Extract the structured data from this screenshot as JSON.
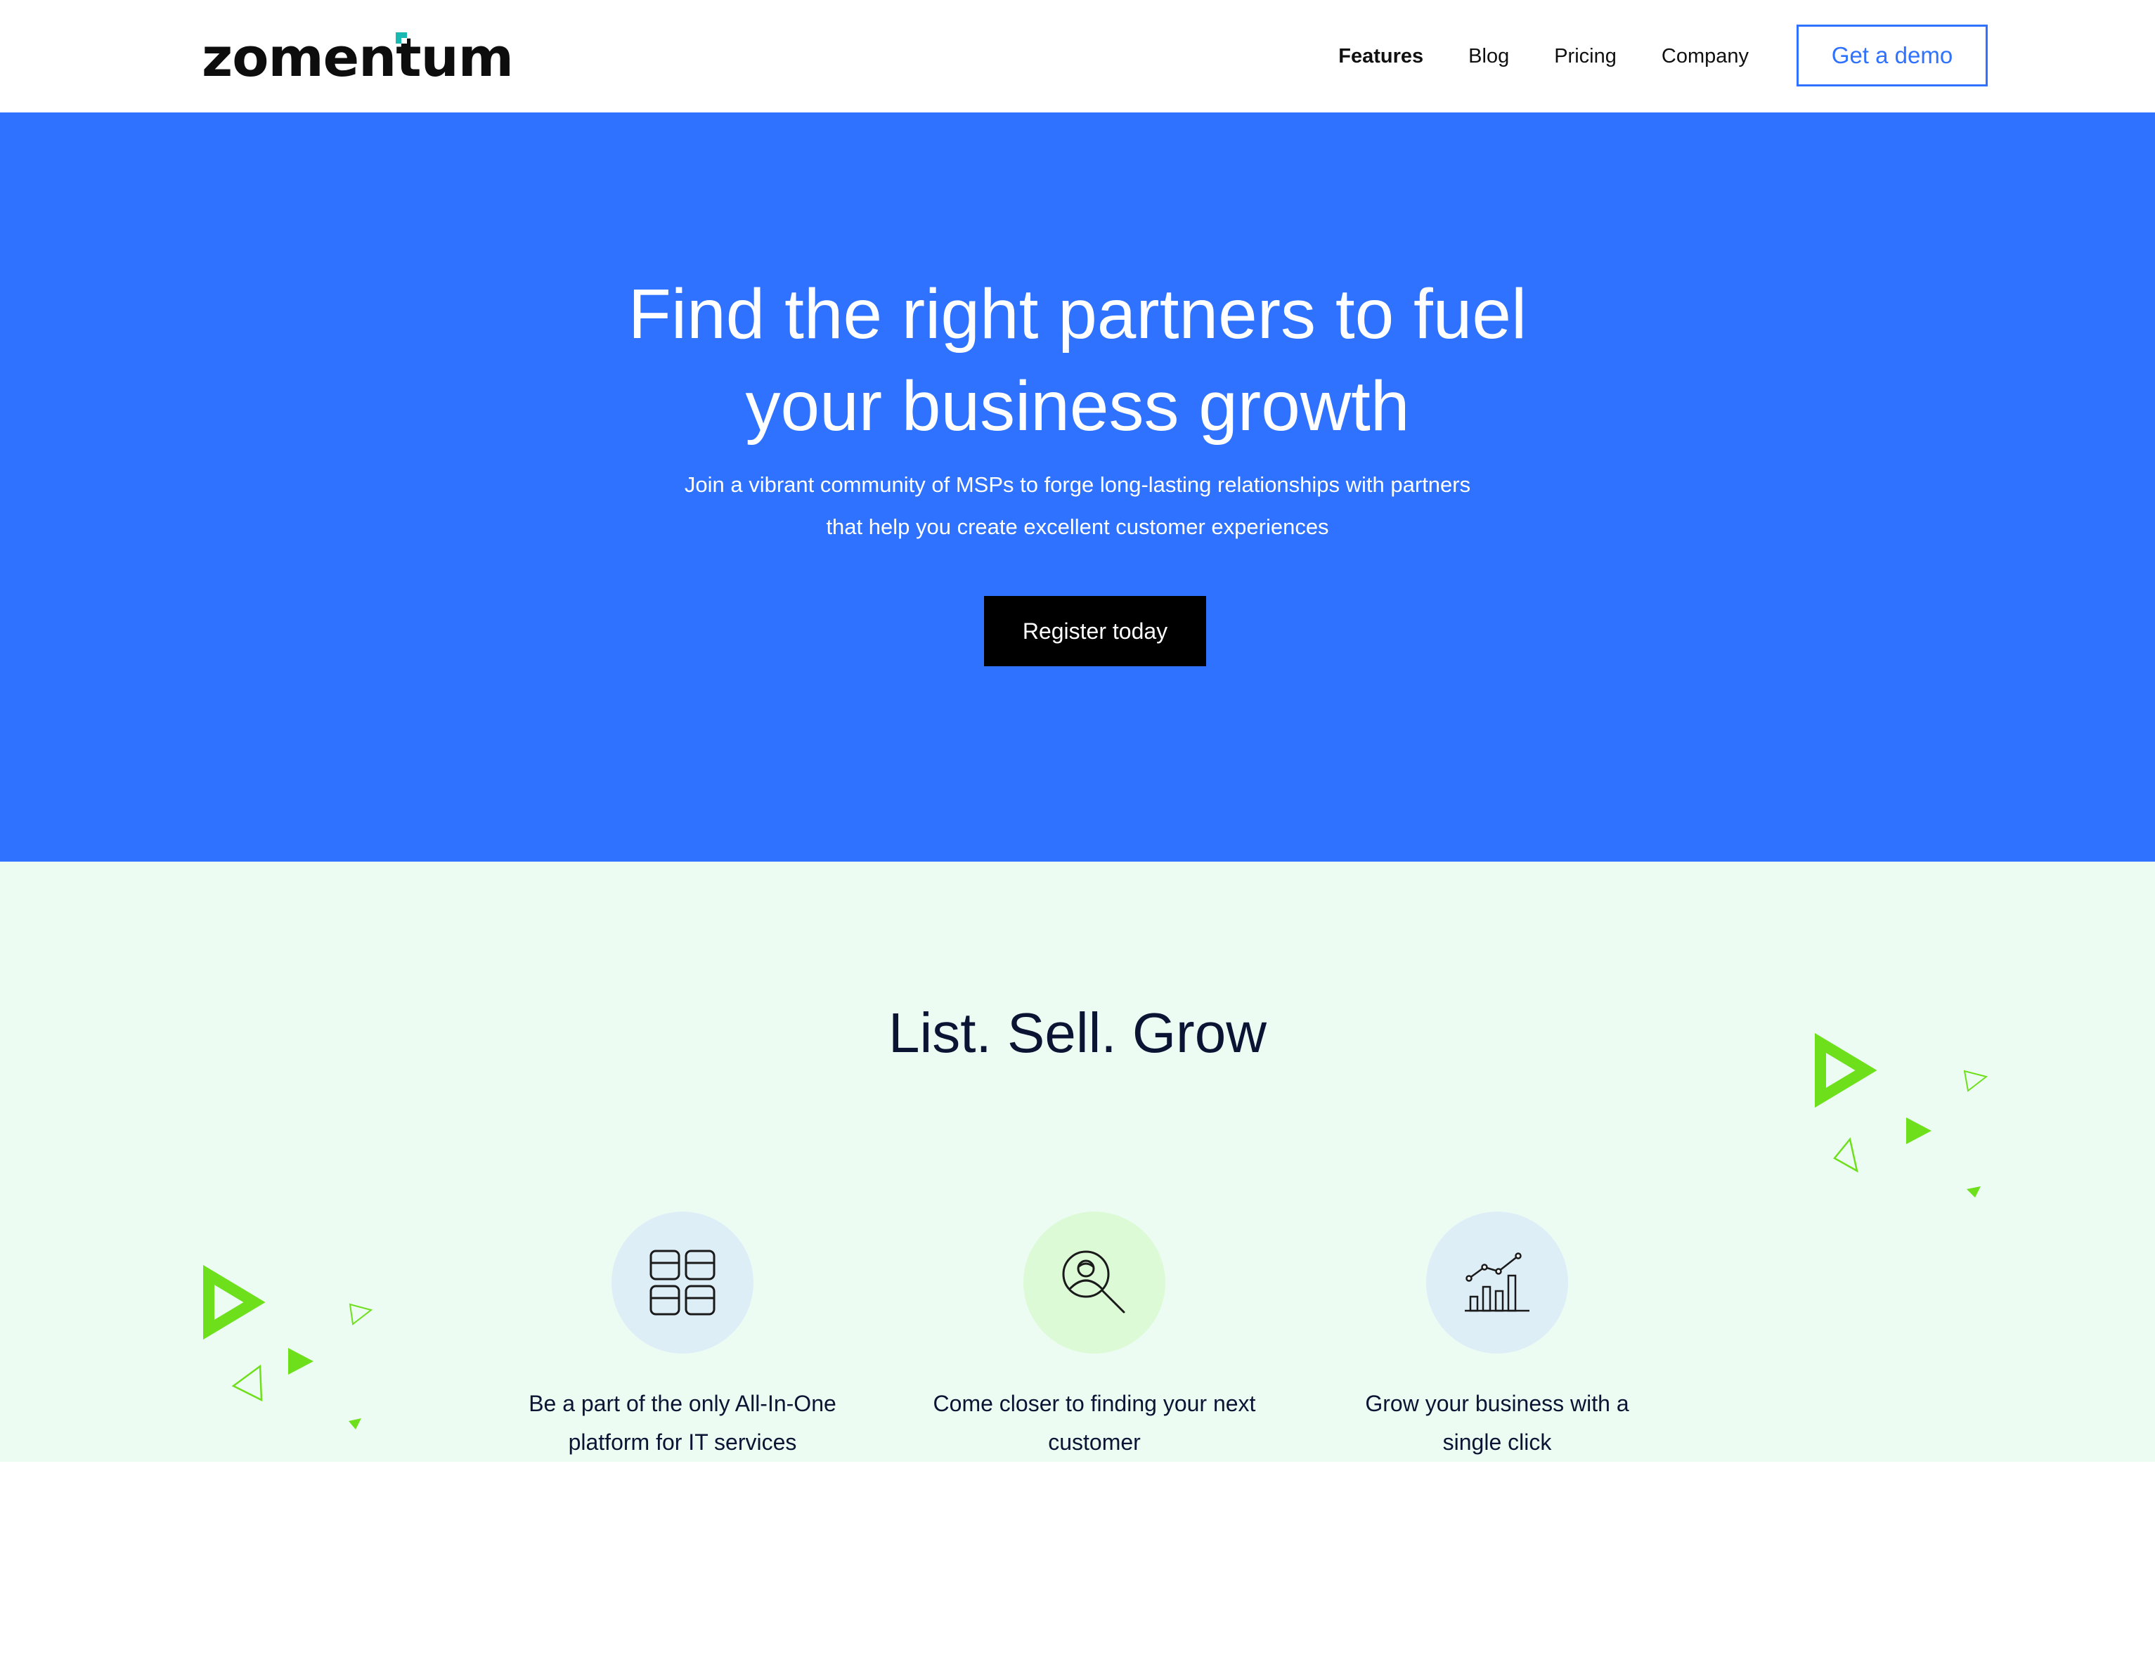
{
  "nav": {
    "logo_text": "zomentum",
    "links": [
      {
        "label": "Features",
        "active": true
      },
      {
        "label": "Blog",
        "active": false
      },
      {
        "label": "Pricing",
        "active": false
      },
      {
        "label": "Company",
        "active": false
      }
    ],
    "demo_label": "Get a demo"
  },
  "hero": {
    "title_line1": "Find the right partners to fuel",
    "title_line2": "your business growth",
    "subtitle_line1": "Join a vibrant community of MSPs to forge long-lasting relationships with partners",
    "subtitle_line2": "that help you create excellent customer experiences",
    "cta_label": "Register today"
  },
  "features": {
    "title": "List. Sell. Grow",
    "items": [
      {
        "icon": "grid-layout-icon",
        "line1": "Be a part of the only All-In-One",
        "line2": "platform for IT services"
      },
      {
        "icon": "person-search-icon",
        "line1": "Come closer to finding your next",
        "line2": "customer"
      },
      {
        "icon": "growth-chart-icon",
        "line1": "Grow your business with a",
        "line2": "single click"
      }
    ]
  },
  "colors": {
    "brand_blue": "#2e72ff",
    "accent_green": "#6ee01b",
    "features_bg": "#edfcf3",
    "text_dark": "#0b1433"
  }
}
